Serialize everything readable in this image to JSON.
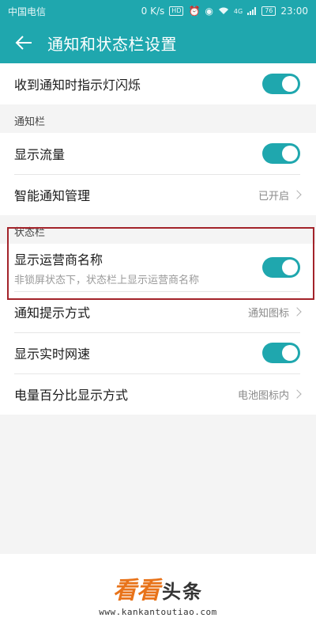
{
  "status_bar": {
    "carrier": "中国电信",
    "speed": "0 K/s",
    "hd_badge": "HD",
    "network_badge": "4G",
    "battery": "76",
    "time": "23:00"
  },
  "header": {
    "title": "通知和状态栏设置",
    "back_icon": "arrow-left-icon"
  },
  "rows_top": [
    {
      "label": "收到通知时指示灯闪烁",
      "toggle": true
    }
  ],
  "notification_section": {
    "header": "通知栏",
    "rows": [
      {
        "label": "显示流量",
        "toggle": true
      },
      {
        "label": "智能通知管理",
        "value": "已开启"
      }
    ]
  },
  "status_section": {
    "header": "状态栏",
    "rows": [
      {
        "label": "显示运营商名称",
        "sublabel": "非锁屏状态下，状态栏上显示运营商名称",
        "toggle": true
      },
      {
        "label": "通知提示方式",
        "value": "通知图标"
      },
      {
        "label": "显示实时网速",
        "toggle": true
      },
      {
        "label": "电量百分比显示方式",
        "value": "电池图标内"
      }
    ]
  },
  "watermark": {
    "logo_main": "看看",
    "logo_sub": "头条",
    "url": "www.kankantoutiao.com"
  },
  "colors": {
    "accent": "#1fa7ae",
    "highlight_box": "#a3232a"
  }
}
